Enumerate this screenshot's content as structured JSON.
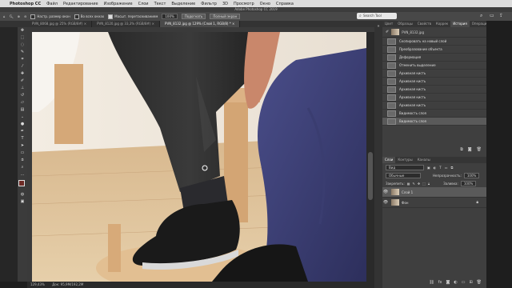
{
  "menubar": {
    "app": "Photoshop CC",
    "items": [
      "Файл",
      "Редактирование",
      "Изображение",
      "Слои",
      "Текст",
      "Выделение",
      "Фильтр",
      "3D",
      "Просмотр",
      "Окно",
      "Справка"
    ]
  },
  "window_title": "Adobe Photoshop CC 2019",
  "options": {
    "chk1": "Настр. размер окон",
    "chk2": "Во всех окнах",
    "chk3": "Масшт. перетаскиванием",
    "zoom": "100%",
    "fit": "Подогнать",
    "fill": "Полный экран",
    "search_placeholder": "Search Tool"
  },
  "tabs": [
    {
      "label": "PVN_8068.jpg @ 25% (RGB/8#) ×"
    },
    {
      "label": "PVN_8120.jpg @ 33,3% (RGB/8#) ×"
    },
    {
      "label": "PVN_8132.jpg @ 129% (Слой 1, RGB/8) * ×"
    }
  ],
  "status": {
    "zoom": "129,43%",
    "doc": "Док: 95,9M/192,2M"
  },
  "history_panel": {
    "tabs": [
      "Цвет",
      "Образцы",
      "Свойств",
      "Коррек",
      "История",
      "Операции"
    ],
    "snapshot": "PVN_8132.jpg",
    "items": [
      "Скопировать на новый слой",
      "Преобразование объекта",
      "Деформация",
      "Отменить выделение",
      "Архивная кисть",
      "Архивная кисть",
      "Архивная кисть",
      "Архивная кисть",
      "Архивная кисть",
      "Видимость слоя",
      "Видимость слоя"
    ]
  },
  "layers_panel": {
    "tabs": [
      "Слои",
      "Контуры",
      "Каналы"
    ],
    "filter": "Вид",
    "blend": "Обычные",
    "opacity_label": "Непрозрачность:",
    "opacity": "100%",
    "lock_label": "Закрепить:",
    "fill_label": "Заливка:",
    "fill": "100%",
    "layers": [
      {
        "name": "Слой 1",
        "selected": true
      },
      {
        "name": "Фон",
        "selected": false
      }
    ]
  },
  "tools": [
    "move-icon",
    "marquee-icon",
    "lasso-icon",
    "quick-select-icon",
    "crop-icon",
    "eyedropper-icon",
    "healing-icon",
    "brush-icon",
    "stamp-icon",
    "history-brush-icon",
    "eraser-icon",
    "gradient-icon",
    "blur-icon",
    "dodge-icon",
    "pen-icon",
    "type-icon",
    "path-select-icon",
    "shape-icon",
    "hand-icon",
    "zoom-icon"
  ]
}
